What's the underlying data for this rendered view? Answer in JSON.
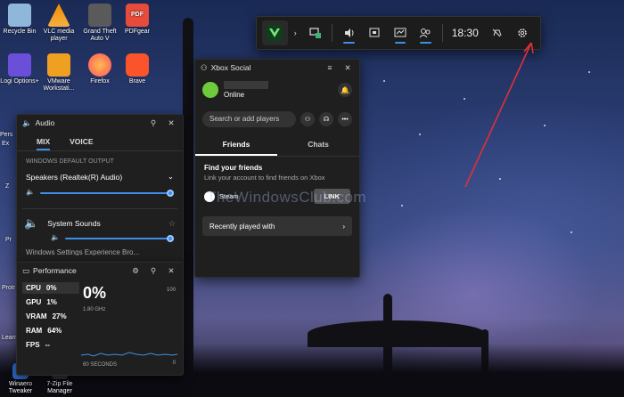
{
  "desktop": {
    "icons": [
      {
        "label": "Recycle Bin",
        "color": "#8fb7d9"
      },
      {
        "label": "VLC media player",
        "color": "#f08a00"
      },
      {
        "label": "Grand Theft Auto V",
        "color": "#5a5a5a"
      },
      {
        "label": "PDFgear",
        "color": "#e84b3c"
      },
      {
        "label": "Logi Options+",
        "color": "#6b4fd8"
      },
      {
        "label": "VMware Workstati...",
        "color": "#f0a020"
      },
      {
        "label": "Firefox",
        "color": "#ff7a1a"
      },
      {
        "label": "Brave",
        "color": "#fb542b"
      }
    ],
    "left_edge_fragments": [
      "Pers",
      "Ex",
      "Z",
      "Pr",
      "Protr",
      "Learn",
      "Winaero Tweaker",
      "7-Zip File Manager"
    ]
  },
  "gamebar": {
    "time": "18:30",
    "items": [
      "xbox-logo",
      "chevron-right",
      "capture",
      "audio",
      "performance",
      "resources",
      "social",
      "controller",
      "settings"
    ]
  },
  "audio": {
    "title": "Audio",
    "tabs": [
      "MIX",
      "VOICE"
    ],
    "section": "WINDOWS DEFAULT OUTPUT",
    "device": "Speakers (Realtek(R) Audio)",
    "device_volume": 1.0,
    "app": "System Sounds",
    "app_volume": 1.0,
    "cut_text": "Windows Settings Experience Bro..."
  },
  "performance": {
    "title": "Performance",
    "stats": [
      {
        "label": "CPU",
        "value": "0%"
      },
      {
        "label": "GPU",
        "value": "1%"
      },
      {
        "label": "VRAM",
        "value": "27%"
      },
      {
        "label": "RAM",
        "value": "64%"
      },
      {
        "label": "FPS",
        "value": "--"
      }
    ],
    "big_value": "0%",
    "freq": "1.80 GHz",
    "max": "100",
    "min": "0",
    "window": "60 SECONDS"
  },
  "social": {
    "title": "Xbox Social",
    "status": "Online",
    "search_placeholder": "Search or add players",
    "tabs": [
      "Friends",
      "Chats"
    ],
    "find_title": "Find your friends",
    "find_desc": "Link your account to find friends on Xbox",
    "steam": "Steam",
    "link_button": "LINK",
    "recent": "Recently played with"
  },
  "watermark": "TheWindowsClub.com",
  "colors": {
    "accent": "#3d8ee8",
    "panel": "#1f1f1f",
    "xbox_green": "#107c10",
    "annotation": "#e0303a"
  }
}
